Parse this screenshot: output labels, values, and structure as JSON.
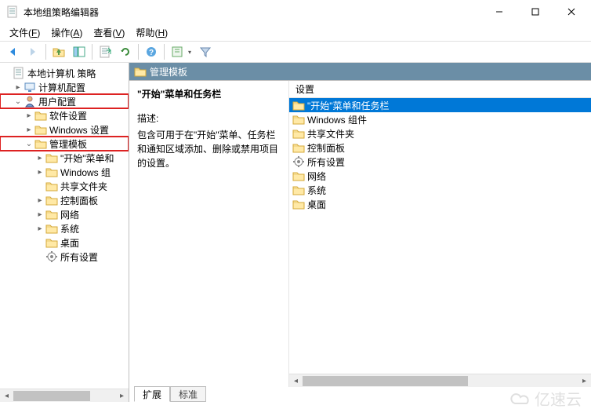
{
  "window": {
    "title": "本地组策略编辑器"
  },
  "menubar": [
    {
      "label": "文件",
      "key": "F"
    },
    {
      "label": "操作",
      "key": "A"
    },
    {
      "label": "查看",
      "key": "V"
    },
    {
      "label": "帮助",
      "key": "H"
    }
  ],
  "toolbar": {
    "back": "后退",
    "forward": "前进",
    "up": "上一级",
    "show_hide": "显示/隐藏",
    "properties": "属性",
    "export": "导出",
    "refresh": "刷新",
    "help": "帮助",
    "filter_dd": "筛选",
    "filter": "筛选器"
  },
  "tree": {
    "root": "本地计算机 策略",
    "computer_config": "计算机配置",
    "user_config": "用户配置",
    "software_settings": "软件设置",
    "windows_settings": "Windows 设置",
    "admin_templates": "管理模板",
    "start_taskbar": "\"开始\"菜单和",
    "windows_components": "Windows 组",
    "shared_folders": "共享文件夹",
    "control_panel": "控制面板",
    "network": "网络",
    "system": "系统",
    "desktop": "桌面",
    "all_settings": "所有设置"
  },
  "path_header": "管理模板",
  "desc": {
    "title": "\"开始\"菜单和任务栏",
    "label": "描述:",
    "text": "包含可用于在\"开始\"菜单、任务栏和通知区域添加、删除或禁用项目的设置。"
  },
  "list": {
    "header": "设置",
    "items": [
      {
        "label": "\"开始\"菜单和任务栏",
        "type": "folder",
        "selected": true
      },
      {
        "label": "Windows 组件",
        "type": "folder"
      },
      {
        "label": "共享文件夹",
        "type": "folder"
      },
      {
        "label": "控制面板",
        "type": "folder"
      },
      {
        "label": "所有设置",
        "type": "settings"
      },
      {
        "label": "网络",
        "type": "folder"
      },
      {
        "label": "系统",
        "type": "folder"
      },
      {
        "label": "桌面",
        "type": "folder"
      }
    ]
  },
  "tabs": {
    "extended": "扩展",
    "standard": "标准"
  },
  "watermark": "亿速云"
}
